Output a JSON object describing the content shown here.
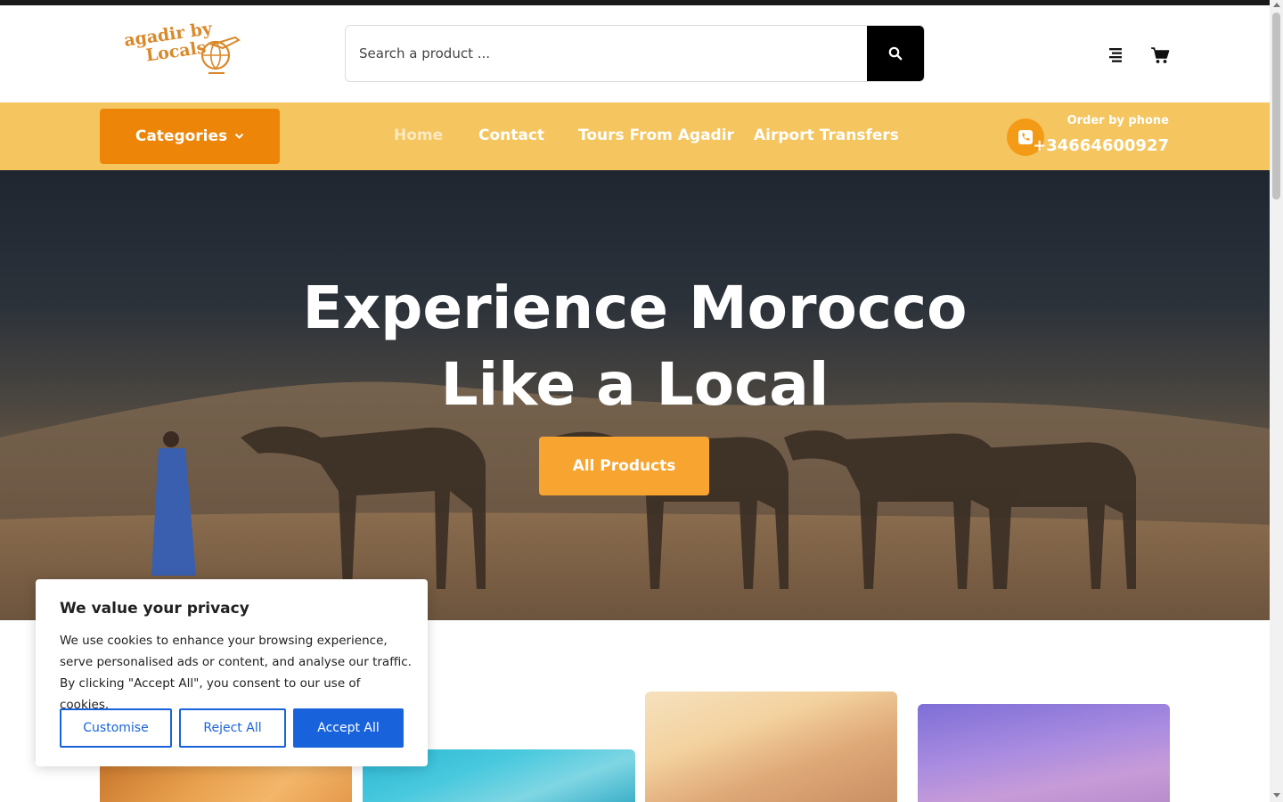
{
  "colors": {
    "accent_orange": "#ec8508",
    "navbar_yellow": "#f5c55f",
    "hero_button": "#f7a430",
    "cookie_blue": "#1863dc"
  },
  "header": {
    "logo_line1": "agadir by",
    "logo_line2": "Locals",
    "search_placeholder": "Search a product ...",
    "icons": [
      "search-icon",
      "menu-icon",
      "cart-icon"
    ]
  },
  "nav": {
    "categories_label": "Categories",
    "links": [
      {
        "label": "Home",
        "active": true
      },
      {
        "label": "Contact",
        "active": false
      },
      {
        "label": "Tours From Agadir",
        "active": false
      },
      {
        "label": "Airport Transfers",
        "active": false
      }
    ],
    "order_label": "Order by phone",
    "phone_number": "+34664600927"
  },
  "hero": {
    "title": "Experience Morocco Like a Local",
    "button_label": "All Products"
  },
  "cookie": {
    "title": "We value your privacy",
    "text": "We use cookies to enhance your browsing experience, serve personalised ads or content, and analyse our traffic. By clicking \"Accept All\", you consent to our use of cookies.",
    "customise_label": "Customise",
    "reject_label": "Reject All",
    "accept_label": "Accept All"
  }
}
